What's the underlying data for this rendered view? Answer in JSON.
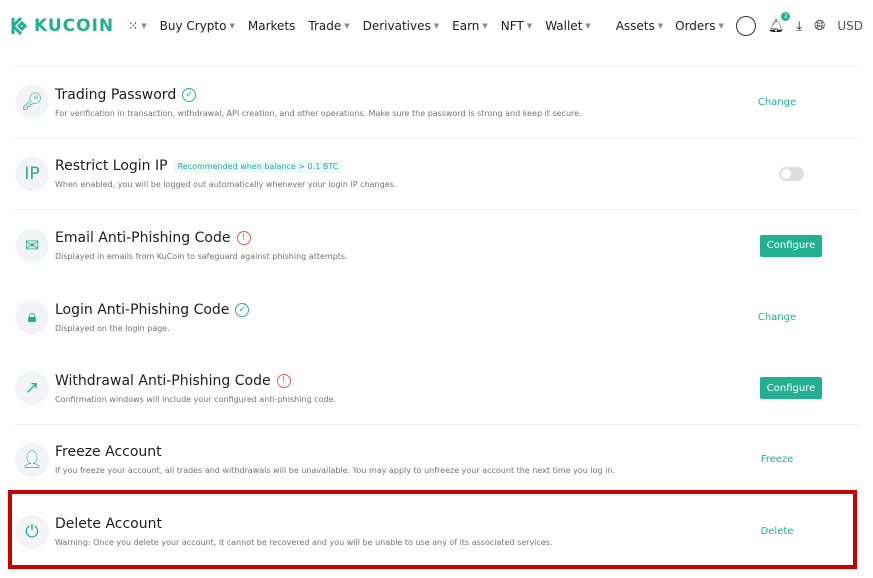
{
  "nav": {
    "logo": "KUCOIN",
    "items": [
      {
        "label": "Buy Crypto",
        "caret": true
      },
      {
        "label": "Markets",
        "caret": false
      },
      {
        "label": "Trade",
        "caret": true
      },
      {
        "label": "Derivatives",
        "caret": true
      },
      {
        "label": "Earn",
        "caret": true
      },
      {
        "label": "NFT",
        "caret": true
      },
      {
        "label": "Wallet",
        "caret": true
      }
    ],
    "assets": "Assets",
    "orders": "Orders",
    "notification_count": "2",
    "currency": "USD"
  },
  "rows": [
    {
      "title": "Trading Password",
      "status": "verified",
      "desc": "For verification in transaction, withdrawal, API creation, and other operations. Make sure the password is strong and keep it secure.",
      "action": "Change",
      "icon": "key-icon"
    },
    {
      "title": "Restrict Login IP",
      "tag": "Recommended when balance > 0.1 BTC",
      "desc": "When enabled, you will be logged out automatically whenever your login IP changes.",
      "toggle": false,
      "icon": "ip-icon",
      "icon_text": "IP"
    },
    {
      "title": "Email Anti-Phishing Code",
      "status": "warning",
      "desc": "Displayed in emails from KuCoin to safeguard against phishing attempts.",
      "button": "Configure",
      "icon": "email-shield-icon"
    },
    {
      "title": "Login Anti-Phishing Code",
      "status": "verified",
      "desc": "Displayed on the login page.",
      "action": "Change",
      "icon": "lock-shield-icon"
    },
    {
      "title": "Withdrawal Anti-Phishing Code",
      "status": "warning",
      "desc": "Confirmation windows will include your configured anti-phishing code.",
      "button": "Configure",
      "icon": "withdraw-shield-icon"
    },
    {
      "title": "Freeze Account",
      "desc": "If you freeze your account, all trades and withdrawals will be unavailable. You may apply to unfreeze your account the next time you log in.",
      "action": "Freeze",
      "icon": "user-freeze-icon"
    },
    {
      "title": "Delete Account",
      "desc": "Warning: Once you delete your account, it cannot be recovered and you will be unable to use any of its associated services.",
      "action": "Delete",
      "icon": "power-icon"
    }
  ],
  "colors": {
    "accent": "#23af91",
    "warning": "#f65454",
    "highlight": "#cc0000"
  }
}
